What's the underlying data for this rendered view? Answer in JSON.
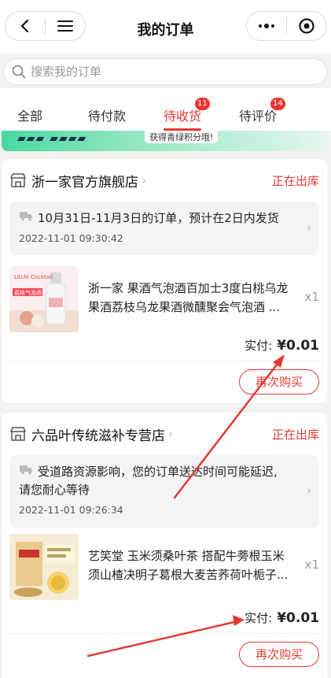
{
  "header": {
    "title": "我的订单"
  },
  "search": {
    "placeholder": "搜索我的订单"
  },
  "tabs": [
    {
      "label": "全部",
      "badge": ""
    },
    {
      "label": "待付款",
      "badge": ""
    },
    {
      "label": "待收货",
      "badge": "11"
    },
    {
      "label": "待评价",
      "badge": "14"
    }
  ],
  "banner": {
    "text": "获得青绿积分哦!"
  },
  "orders": [
    {
      "shop": "浙一家官方旗舰店",
      "status": "正在出库",
      "notice": "10月31日-11月3日的订单，预计在2日内发货",
      "time": "2022-11-01 09:30:42",
      "product_line1": "浙一家 果酒气泡酒百加士3度白桃乌龙",
      "product_line2": "果酒荔枝乌龙果酒微醺聚会气泡酒 ...",
      "qty": "x1",
      "thumb_caption": "荔枝气泡酒",
      "thumb_brand": "Litchi Cocktail",
      "paid_label": "实付:",
      "paid_amount": "¥0.01",
      "button": "再次购买"
    },
    {
      "shop": "六品叶传统滋补专营店",
      "status": "正在出库",
      "notice_line1": "受道路资源影响，您的订单送达时间可能延迟,",
      "notice_line2": "请您耐心等待",
      "time": "2022-11-01 09:26:34",
      "product_line1": "艺笑堂 玉米须桑叶茶 搭配牛蒡根玉米",
      "product_line2": "须山楂决明子葛根大麦苦荞荷叶栀子...",
      "qty": "x1",
      "paid_label": "实付:",
      "paid_amount": "¥0.01",
      "button": "再次购买"
    }
  ],
  "colors": {
    "accent": "#e23b34",
    "annotation": "#e53935"
  }
}
